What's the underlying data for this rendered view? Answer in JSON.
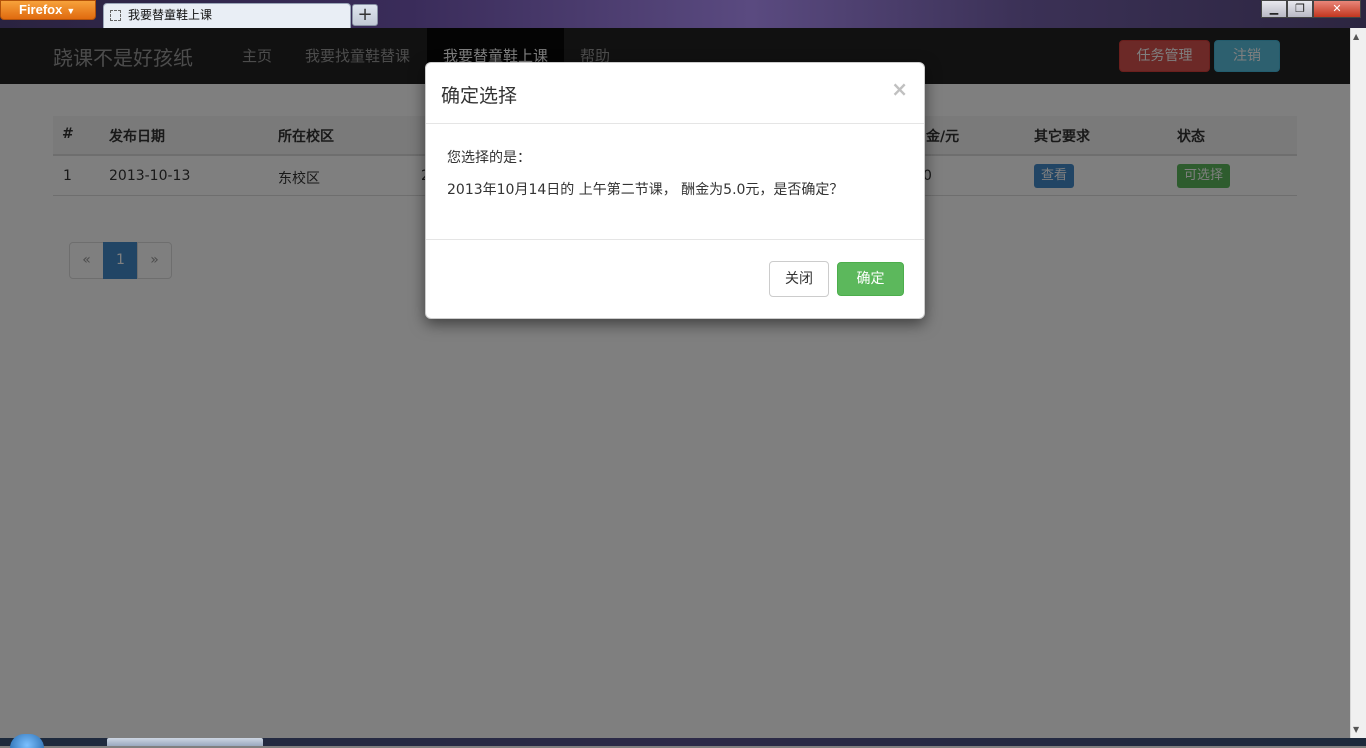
{
  "browser": {
    "menu_button": "Firefox",
    "tab_title": "我要替童鞋上课",
    "new_tab": "+",
    "window_controls": {
      "minimize": "▁",
      "maximize": "❐",
      "close": "✕"
    }
  },
  "navbar": {
    "brand": "跷课不是好孩纸",
    "items": [
      {
        "label": "主页"
      },
      {
        "label": "我要找童鞋替课"
      },
      {
        "label": "我要替童鞋上课"
      },
      {
        "label": "帮助"
      }
    ],
    "task_manage": "任务管理",
    "logout": "注销"
  },
  "table": {
    "headers": [
      "#",
      "发布日期",
      "所在校区",
      "金/元",
      "其它要求",
      "状态"
    ],
    "rows": [
      {
        "index": "1",
        "date": "2013-10-13",
        "campus": "东校区",
        "col4_fragment": "2",
        "reward_fragment": "0",
        "other": "查看",
        "status": "可选择"
      }
    ]
  },
  "pagination": {
    "prev": "«",
    "current": "1",
    "next": "»"
  },
  "modal": {
    "title": "确定选择",
    "close_glyph": "×",
    "line1": "您选择的是：",
    "line2": "2013年10月14日的 上午第二节课， 酬金为5.0元，是否确定？",
    "close_button": "关闭",
    "confirm_button": "确定"
  },
  "colors": {
    "navbar_bg": "#222222",
    "danger": "#d9534f",
    "info": "#5bc0de",
    "primary": "#428bca",
    "success": "#5cb85c"
  }
}
